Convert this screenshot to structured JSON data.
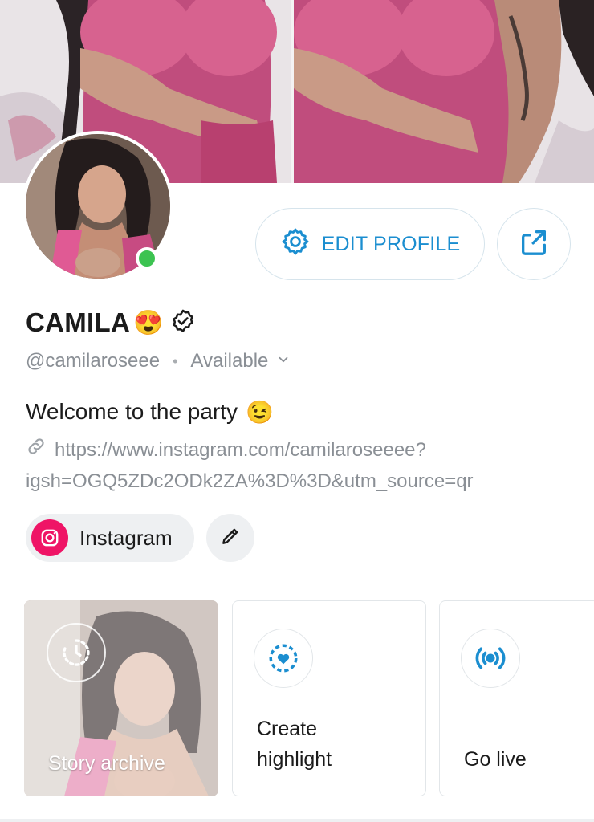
{
  "profile": {
    "name": "CAMILA",
    "name_emoji": "😍",
    "handle": "@camilaroseee",
    "status": "Available",
    "bio_text": "Welcome to the party",
    "bio_emoji": "😉",
    "link_line1": "https://www.instagram.com/camilaroseeee?",
    "link_line2": "igsh=OGQ5ZDc2ODk2ZA%3D%3D&utm_source=qr"
  },
  "actions": {
    "edit_profile_label": "EDIT PROFILE"
  },
  "social": {
    "instagram_label": "Instagram"
  },
  "cards": {
    "story_archive": "Story archive",
    "create_highlight_line1": "Create",
    "create_highlight_line2": "highlight",
    "go_live": "Go live"
  },
  "colors": {
    "accent": "#1b8ed0",
    "online": "#3cc351",
    "instagram": "#ef1466",
    "muted_text": "#8a8f95"
  },
  "icons": {
    "edit": "gear-icon",
    "share": "share-icon",
    "verified": "verified-badge-icon",
    "status": "chevron-down-icon",
    "link": "link-icon",
    "instagram": "instagram-icon",
    "edit_links": "pencil-icon",
    "story_archive": "clock-history-icon",
    "create_highlight": "heart-circle-icon",
    "go_live": "broadcast-icon"
  }
}
